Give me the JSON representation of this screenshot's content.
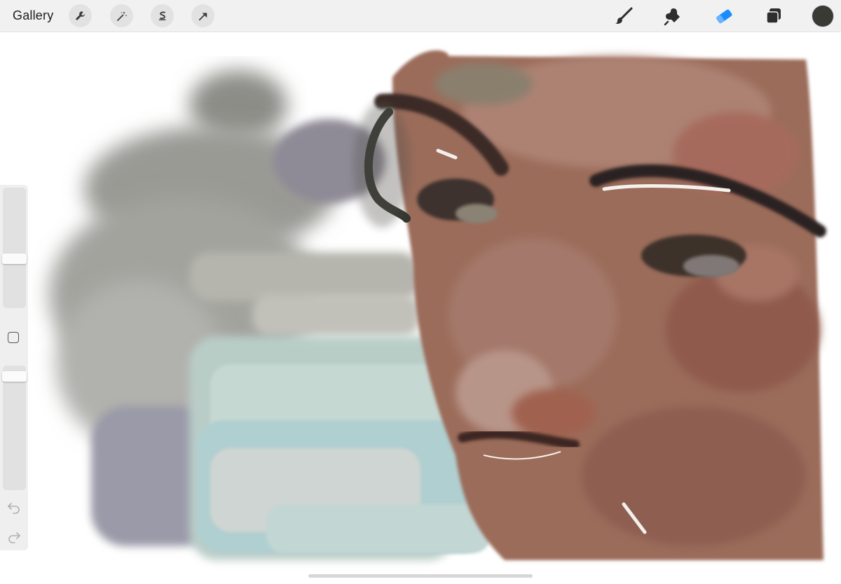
{
  "topbar": {
    "gallery_label": "Gallery",
    "left_tools": [
      "wrench-icon",
      "magic-wand-icon",
      "selection-icon",
      "transform-arrow-icon"
    ],
    "right_tools": [
      "brush-icon",
      "smudge-icon",
      "eraser-icon",
      "layers-icon"
    ],
    "active_tool": "eraser",
    "current_color": "#3a3a34"
  },
  "sidebar": {
    "brush_size_level": 0.4,
    "opacity_level": 0.95,
    "icons": [
      "modify-square-icon",
      "undo-icon",
      "redo-icon"
    ]
  },
  "colors": {
    "accent": "#1a8cff",
    "toolbar_bg": "#f1f1f1"
  }
}
